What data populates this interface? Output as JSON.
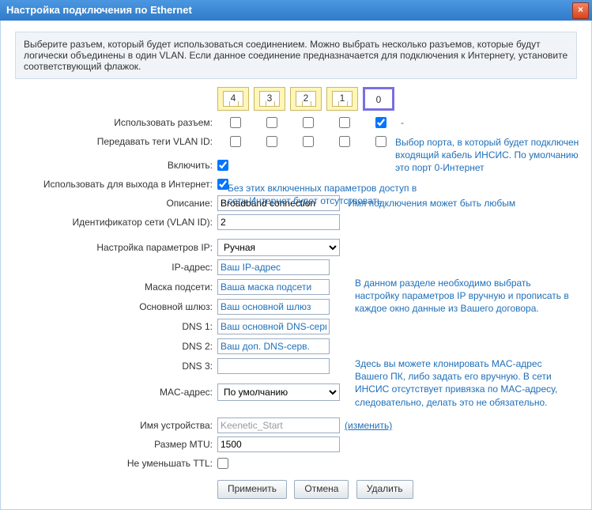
{
  "title": "Настройка подключения по Ethernet",
  "intro": "Выберите разъем, который будет использоваться соединением. Можно выбрать несколько разъемов, которые будут логически объединены в один VLAN. Если данное соединение предназначается для подключения к Интернету, установите соответствующий флажок.",
  "ports": [
    "4",
    "3",
    "2",
    "1",
    "0"
  ],
  "labels": {
    "use_port": "Использовать разъем:",
    "vlan_tags": "Передавать теги VLAN ID:",
    "enable": "Включить:",
    "use_for_internet": "Использовать для выхода в Интернет:",
    "description": "Описание:",
    "vlan_id": "Идентификатор сети (VLAN ID):",
    "ip_mode": "Настройка параметров IP:",
    "ip_addr": "IP-адрес:",
    "mask": "Маска подсети:",
    "gateway": "Основной шлюз:",
    "dns1": "DNS 1:",
    "dns2": "DNS 2:",
    "dns3": "DNS 3:",
    "mac": "MAC-адрес:",
    "device_name": "Имя устройства:",
    "mtu": "Размер MTU:",
    "no_ttl_dec": "Не уменьшать TTL:"
  },
  "values": {
    "description": "Broadband connection",
    "vlan_id": "2",
    "ip_mode": "Ручная",
    "mac": "По умолчанию",
    "device_name_ph": "Keenetic_Start",
    "mtu": "1500"
  },
  "placeholders": {
    "ip_addr": "Ваш IP-адрес",
    "mask": "Ваша маска подсети",
    "gateway": "Ваш основной шлюз",
    "dns1": "Ваш основной DNS-серв.",
    "dns2": "Ваш доп. DNS-серв."
  },
  "notes": {
    "port_select": "Выбор порта, в который будет подключен входящий кабель ИНСИС. По умолчанию это порт 0-Интернет",
    "enable_internet": "Без этих включенных параметров доступ в сеть Интернет будет отсутствовать.",
    "descr_hint": "Имя подключения может быть любым",
    "ip_block": "В данном разделе необходимо выбрать настройку параметров IP вручную и прописать в каждое окно данные из Вашего договора.",
    "mac_block": "Здесь вы можете клонировать MAC-адрес Вашего ПК, либо задать его вручную. В сети ИНСИС отсутствует привязка по MAC-адресу, следовательно, делать это не обязательно.",
    "change_link": "(изменить)"
  },
  "buttons": {
    "apply": "Применить",
    "cancel": "Отмена",
    "delete": "Удалить"
  }
}
